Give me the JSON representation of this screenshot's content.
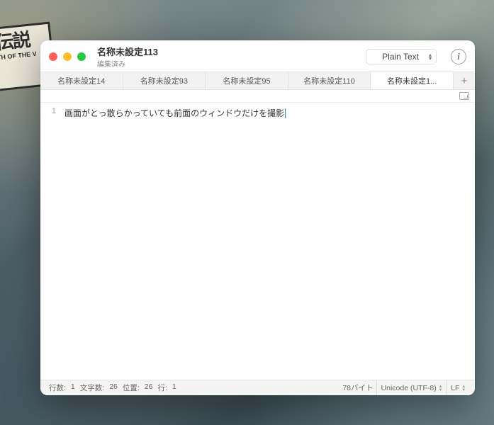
{
  "background": {
    "banner_main": "伝説",
    "banner_sub": "TH OF THE V"
  },
  "window": {
    "title": "名称未設定113",
    "subtitle": "編集済み",
    "format_label": "Plain Text",
    "info_glyph": "i"
  },
  "tabs": [
    {
      "label": "名称未設定14",
      "active": false
    },
    {
      "label": "名称未設定93",
      "active": false
    },
    {
      "label": "名称未設定95",
      "active": false
    },
    {
      "label": "名称未設定110",
      "active": false
    },
    {
      "label": "名称未設定1...",
      "active": true
    }
  ],
  "add_tab_glyph": "+",
  "editor": {
    "gutter_line": "1",
    "line1": "画面がとっ散らかっていても前面のウィンドウだけを撮影"
  },
  "status": {
    "lines_label": "行数:",
    "lines_value": "1",
    "chars_label": "文字数:",
    "chars_value": "26",
    "pos_label": "位置:",
    "pos_value": "26",
    "row_label": "行:",
    "row_value": "1",
    "bytes_value": "78バイト",
    "encoding": "Unicode (UTF-8)",
    "line_ending": "LF"
  }
}
